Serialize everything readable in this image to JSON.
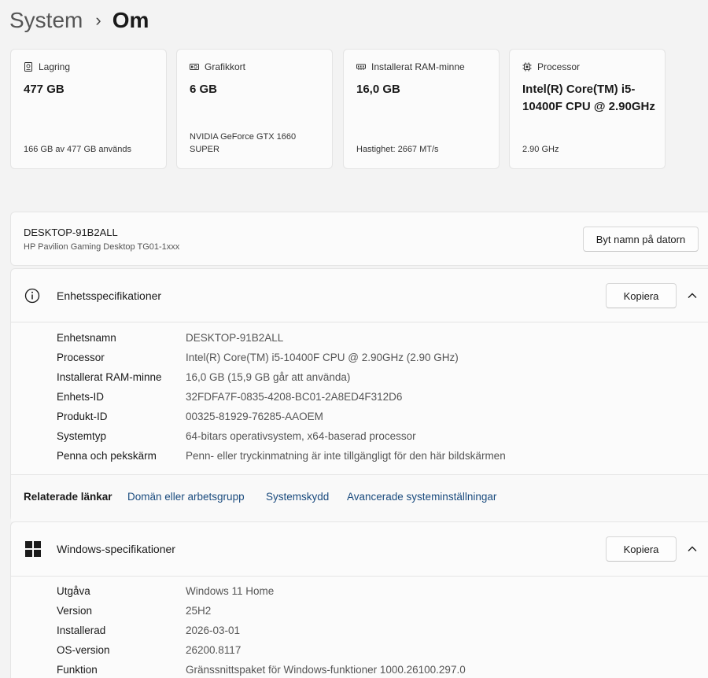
{
  "breadcrumb": {
    "parent": "System",
    "separator": "›",
    "current": "Om"
  },
  "cards": [
    {
      "icon": "storage-icon",
      "label": "Lagring",
      "value": "477 GB",
      "detail": "166 GB av 477 GB används"
    },
    {
      "icon": "graphics-card-icon",
      "label": "Grafikkort",
      "value": "6 GB",
      "detail": "NVIDIA GeForce GTX 1660 SUPER"
    },
    {
      "icon": "memory-icon",
      "label": "Installerat RAM-minne",
      "value": "16,0 GB",
      "detail": "Hastighet: 2667 MT/s"
    },
    {
      "icon": "processor-icon",
      "label": "Processor",
      "value": "Intel(R) Core(TM) i5-10400F CPU @ 2.90GHz",
      "detail": "2.90 GHz"
    }
  ],
  "device": {
    "name": "DESKTOP-91B2ALL",
    "model": "HP Pavilion Gaming Desktop TG01-1xxx",
    "rename_label": "Byt namn på datorn"
  },
  "device_specs": {
    "title": "Enhetsspecifikationer",
    "copy_label": "Kopiera",
    "rows": [
      {
        "key": "Enhetsnamn",
        "value": "DESKTOP-91B2ALL"
      },
      {
        "key": "Processor",
        "value": "Intel(R) Core(TM) i5-10400F CPU @ 2.90GHz (2.90 GHz)"
      },
      {
        "key": "Installerat RAM-minne",
        "value": "16,0 GB (15,9 GB går att använda)"
      },
      {
        "key": "Enhets-ID",
        "value": "32FDFA7F-0835-4208-BC01-2A8ED4F312D6"
      },
      {
        "key": "Produkt-ID",
        "value": "00325-81929-76285-AAOEM"
      },
      {
        "key": "Systemtyp",
        "value": "64-bitars operativsystem, x64-baserad processor"
      },
      {
        "key": "Penna och pekskärm",
        "value": "Penn- eller tryckinmatning är inte tillgängligt för den här bildskärmen"
      }
    ]
  },
  "related_links": {
    "title": "Relaterade länkar",
    "links": [
      "Domän eller arbetsgrupp",
      "Systemskydd",
      "Avancerade systeminställningar"
    ]
  },
  "windows_specs": {
    "title": "Windows-specifikationer",
    "copy_label": "Kopiera",
    "rows": [
      {
        "key": "Utgåva",
        "value": "Windows 11 Home"
      },
      {
        "key": "Version",
        "value": "25H2"
      },
      {
        "key": "Installerad",
        "value": "2026-03-01"
      },
      {
        "key": "OS-version",
        "value": "26200.8117"
      },
      {
        "key": "Funktion",
        "value": "Gränssnittspaket för Windows-funktioner 1000.26100.297.0"
      }
    ]
  },
  "colors": {
    "accent_link": "#1a4b7e",
    "windows_logo": "#1a1a1a"
  }
}
